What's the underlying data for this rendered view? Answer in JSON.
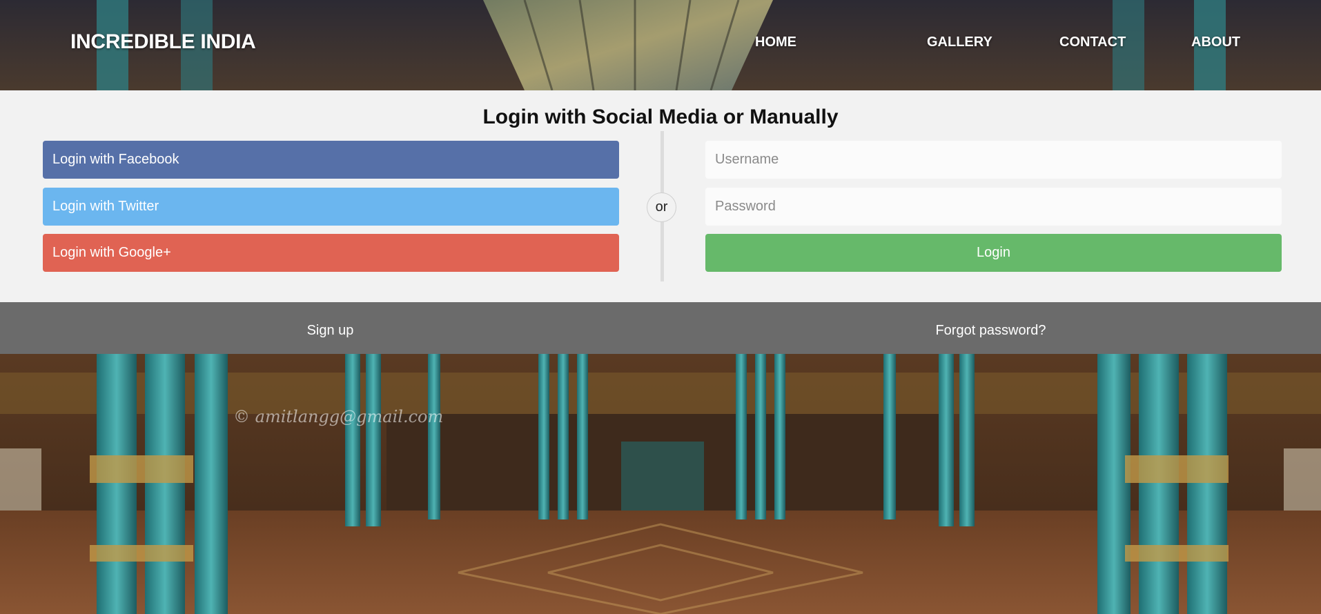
{
  "header": {
    "brand": "INCREDIBLE INDIA",
    "nav": {
      "home": "HOME",
      "gallery": "GALLERY",
      "contact": "CONTACT",
      "about": "ABOUT"
    }
  },
  "login": {
    "title": "Login with Social Media or Manually",
    "facebook_label": "Login with Facebook",
    "twitter_label": "Login with Twitter",
    "google_label": "Login with Google+",
    "separator": "or",
    "username_placeholder": "Username",
    "password_placeholder": "Password",
    "submit_label": "Login"
  },
  "footer_links": {
    "signup": "Sign up",
    "forgot": "Forgot password?"
  },
  "background": {
    "watermark": "© amitlangg@gmail.com"
  },
  "colors": {
    "facebook": "#5670a8",
    "twitter": "#6bb6ef",
    "google": "#e06353",
    "login_button": "#66b96a",
    "panel": "#f2f2f2",
    "link_bar": "#6b6b6b"
  }
}
